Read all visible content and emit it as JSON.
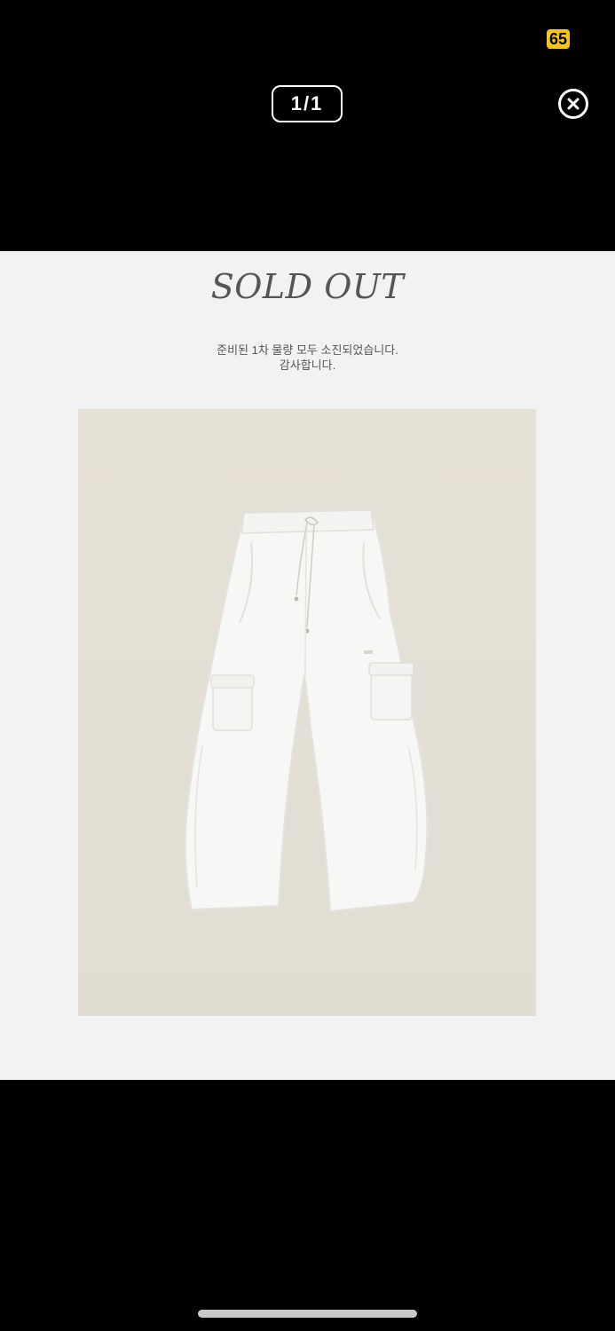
{
  "status_bar": {
    "battery_level": "65",
    "battery_color": "#f7c51a"
  },
  "viewer": {
    "page_counter": "1/1",
    "close_icon": "close-circle-icon"
  },
  "content": {
    "headline": "SOLD OUT",
    "notice_lines": [
      "준비된 1차 물량 모두 소진되었습니다.",
      "감사합니다."
    ],
    "product_image": "white-cargo-pants-photo"
  },
  "colors": {
    "viewer_background": "#000000",
    "panel_background": "#f2f2f2",
    "photo_background": "#e4dfd5"
  }
}
